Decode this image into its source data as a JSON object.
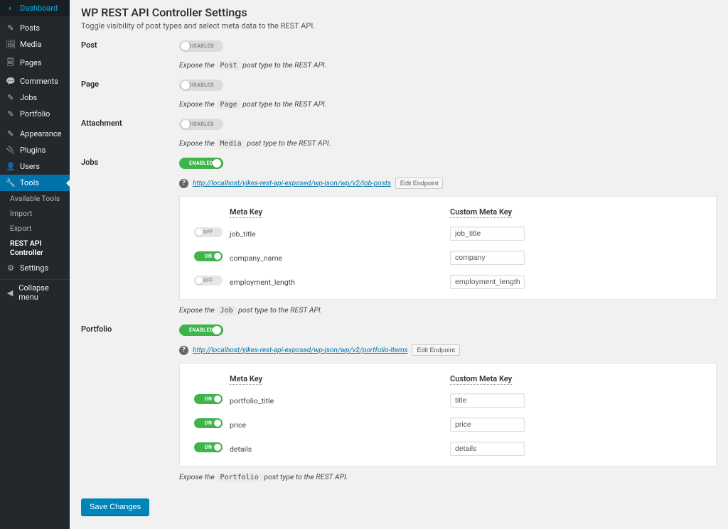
{
  "sidebar": {
    "items": [
      {
        "icon": "◐",
        "label": "Dashboard"
      },
      {
        "icon": "✎",
        "label": "Posts"
      },
      {
        "icon": "🖼",
        "label": "Media"
      },
      {
        "icon": "🗐",
        "label": "Pages"
      },
      {
        "icon": "💬",
        "label": "Comments"
      },
      {
        "icon": "✎",
        "label": "Jobs"
      },
      {
        "icon": "✎",
        "label": "Portfolio"
      },
      {
        "icon": "✎",
        "label": "Appearance"
      },
      {
        "icon": "🔌",
        "label": "Plugins"
      },
      {
        "icon": "👤",
        "label": "Users"
      },
      {
        "icon": "🔧",
        "label": "Tools"
      }
    ],
    "subitems": [
      "Available Tools",
      "Import",
      "Export",
      "REST API Controller"
    ],
    "after_tools": [
      {
        "icon": "⚙",
        "label": "Settings"
      }
    ],
    "collapse": "Collapse menu"
  },
  "header": {
    "title": "WP REST API Controller Settings",
    "desc": "Toggle visibility of post types and select meta data to the REST API."
  },
  "toggle_labels": {
    "on": "ENABLED",
    "off": "DISABLED",
    "row_on": "ON",
    "row_off": "OFF"
  },
  "table_headers": {
    "meta_key": "Meta Key",
    "custom_key": "Custom Meta Key"
  },
  "buttons": {
    "edit_endpoint": "Edit Endpoint",
    "save": "Save Changes"
  },
  "expose": {
    "prefix": "Expose the ",
    "suffix": " post type to the REST API."
  },
  "sections": [
    {
      "id": "post",
      "label": "Post",
      "enabled": false,
      "code": "Post"
    },
    {
      "id": "page",
      "label": "Page",
      "enabled": false,
      "code": "Page"
    },
    {
      "id": "attachment",
      "label": "Attachment",
      "enabled": false,
      "code": "Media"
    },
    {
      "id": "jobs",
      "label": "Jobs",
      "enabled": true,
      "code": "Job",
      "endpoint": "http://localhost/yikes-rest-api-exposed/wp-json/wp/v2/job-posts",
      "meta": [
        {
          "on": false,
          "key": "job_title",
          "custom": "job_title"
        },
        {
          "on": true,
          "key": "company_name",
          "custom": "company"
        },
        {
          "on": false,
          "key": "employment_length",
          "custom": "employment_length"
        }
      ]
    },
    {
      "id": "portfolio",
      "label": "Portfolio",
      "enabled": true,
      "code": "Portfolio",
      "endpoint": "http://localhost/yikes-rest-api-exposed/wp-json/wp/v2/portfolio-items",
      "meta": [
        {
          "on": true,
          "key": "portfolio_title",
          "custom": "title"
        },
        {
          "on": true,
          "key": "price",
          "custom": "price"
        },
        {
          "on": true,
          "key": "details",
          "custom": "details"
        }
      ]
    }
  ]
}
